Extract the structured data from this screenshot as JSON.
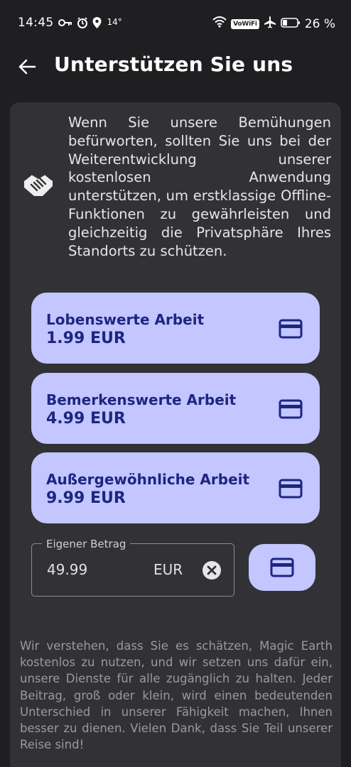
{
  "status_bar": {
    "time": "14:45",
    "temperature": "14°",
    "vowifi": "VoWiFi",
    "battery": "26 %",
    "icons": [
      "key-icon",
      "alarm-icon",
      "location-icon",
      "wifi-icon",
      "airplane-icon",
      "battery-icon"
    ]
  },
  "app_bar": {
    "back_icon": "arrow-left-icon",
    "title": "Unterstützen Sie uns"
  },
  "intro": {
    "icon": "handshake-icon",
    "text": "Wenn Sie unsere Bemühungen befürworten, sollten Sie uns bei der Weiterentwicklung unserer kostenlosen Anwendung unterstützen, um erstklassige Offline-Funktionen zu gewährleisten und gleichzeitig die Privatsphäre Ihres Standorts zu schützen."
  },
  "plans": [
    {
      "name": "Lobenswerte Arbeit",
      "price": "1.99 EUR",
      "icon": "credit-card-icon"
    },
    {
      "name": "Bemerkenswerte Arbeit",
      "price": "4.99 EUR",
      "icon": "credit-card-icon"
    },
    {
      "name": "Außergewöhnliche Arbeit",
      "price": "9.99 EUR",
      "icon": "credit-card-icon"
    }
  ],
  "custom_amount": {
    "label": "Eigener Betrag",
    "value": "49.99",
    "currency": "EUR",
    "clear_icon": "clear-circle-icon",
    "pay_icon": "credit-card-icon"
  },
  "footer": {
    "text": "Wir verstehen, dass Sie es schätzen, Magic Earth kostenlos zu nutzen, und wir setzen uns dafür ein, unsere Dienste für alle zugänglich zu halten. Jeder Beitrag, groß oder klein, wird einen bedeutenden Unterschied in unserer Fähigkeit machen, Ihnen besser zu dienen. Vielen Dank, dass Sie Teil unserer Reise sind!"
  },
  "colors": {
    "background": "#1f1f22",
    "card": "#323236",
    "accent": "#c3c6ff",
    "accent_text": "#1d2680"
  }
}
